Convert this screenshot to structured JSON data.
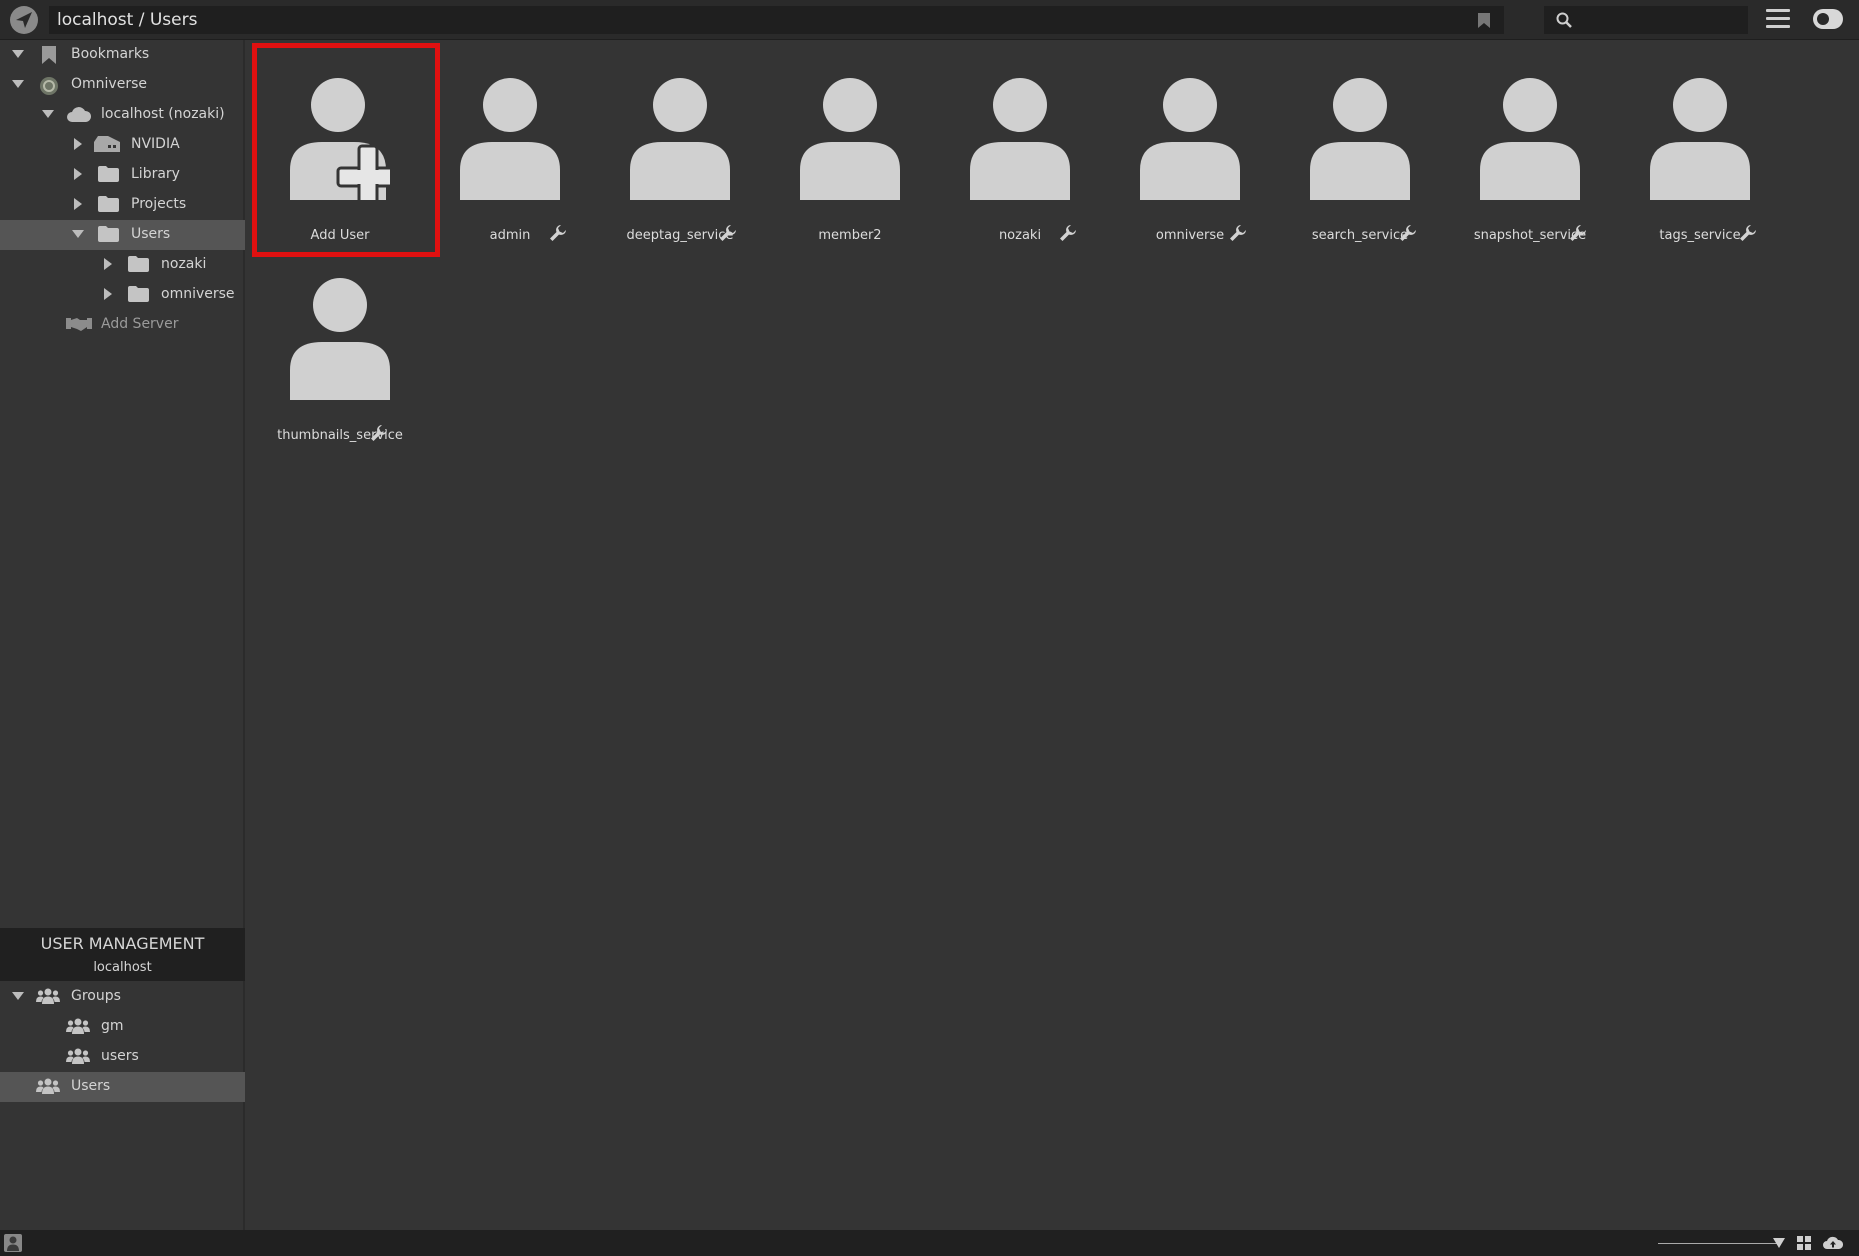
{
  "header": {
    "path": "localhost / Users",
    "search_placeholder": "",
    "logo_icon": "omniverse-launcher-icon",
    "bookmark_icon": "bookmark-icon",
    "search_icon": "search-icon",
    "menu_icon": "hamburger-menu-icon",
    "toggle_icon": "toggle-switch-icon"
  },
  "sidebar": {
    "tree": [
      {
        "label": "Bookmarks",
        "icon": "bookmark-icon",
        "expanded": true
      },
      {
        "label": "Omniverse",
        "icon": "omniverse-icon",
        "expanded": true
      },
      {
        "label": "localhost (nozaki)",
        "icon": "cloud-icon",
        "expanded": true
      },
      {
        "label": "NVIDIA",
        "icon": "server-icon",
        "expanded": false
      },
      {
        "label": "Library",
        "icon": "folder-icon",
        "expanded": false
      },
      {
        "label": "Projects",
        "icon": "folder-icon",
        "expanded": false
      },
      {
        "label": "Users",
        "icon": "folder-icon",
        "expanded": true,
        "selected": true
      },
      {
        "label": "nozaki",
        "icon": "folder-icon",
        "expanded": false
      },
      {
        "label": "omniverse",
        "icon": "folder-icon",
        "expanded": false
      },
      {
        "label": "Add Server",
        "icon": "handshake-icon"
      }
    ],
    "user_management": {
      "title": "USER MANAGEMENT",
      "server": "localhost",
      "items": [
        {
          "label": "Groups",
          "icon": "group-icon",
          "expanded": true
        },
        {
          "label": "gm",
          "icon": "group-icon"
        },
        {
          "label": "users",
          "icon": "group-icon"
        },
        {
          "label": "Users",
          "icon": "group-icon",
          "selected": true
        }
      ]
    }
  },
  "main": {
    "users": [
      {
        "name": "Add User",
        "icon": "add-user-icon",
        "wrench": false
      },
      {
        "name": "admin",
        "icon": "user-avatar-icon",
        "wrench": true
      },
      {
        "name": "deeptag_service",
        "icon": "user-avatar-icon",
        "wrench": true
      },
      {
        "name": "member2",
        "icon": "user-avatar-icon",
        "wrench": false
      },
      {
        "name": "nozaki",
        "icon": "user-avatar-icon",
        "wrench": true
      },
      {
        "name": "omniverse",
        "icon": "user-avatar-icon",
        "wrench": true
      },
      {
        "name": "search_service",
        "icon": "user-avatar-icon",
        "wrench": true
      },
      {
        "name": "snapshot_service",
        "icon": "user-avatar-icon",
        "wrench": true
      },
      {
        "name": "tags_service",
        "icon": "user-avatar-icon",
        "wrench": true
      },
      {
        "name": "thumbnails_service",
        "icon": "user-avatar-icon",
        "wrench": true
      }
    ],
    "highlight_color": "#e01010"
  },
  "footer": {
    "user_icon": "user-icon",
    "grid_icon": "grid-view-icon",
    "cloud_icon": "cloud-upload-icon"
  }
}
